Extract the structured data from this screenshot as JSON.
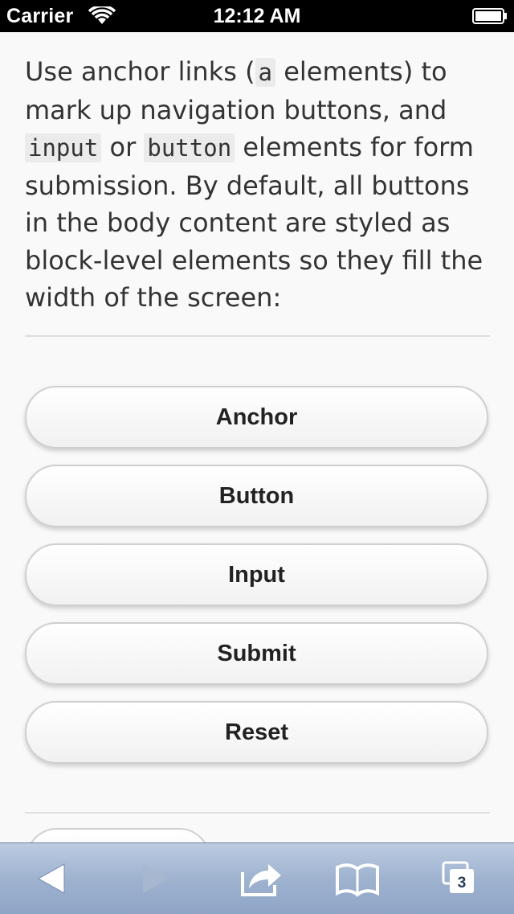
{
  "status_bar": {
    "carrier": "Carrier",
    "time": "12:12 AM"
  },
  "intro": {
    "part1": "Use anchor links (",
    "code_a": "a",
    "part2": " elements) to mark up navigation buttons, and ",
    "code_input": "input",
    "part3": " or ",
    "code_button": "button",
    "part4": " elements for form submission. By default, all buttons in the body content are styled as block-level elements so they fill the width of the screen:"
  },
  "buttons": [
    {
      "label": "Anchor"
    },
    {
      "label": "Button"
    },
    {
      "label": "Input"
    },
    {
      "label": "Submit"
    },
    {
      "label": "Reset"
    }
  ],
  "toolbar": {
    "tabs_count": "3",
    "icons": [
      "back-icon",
      "forward-icon",
      "share-icon",
      "bookmarks-icon",
      "tabs-icon"
    ]
  }
}
